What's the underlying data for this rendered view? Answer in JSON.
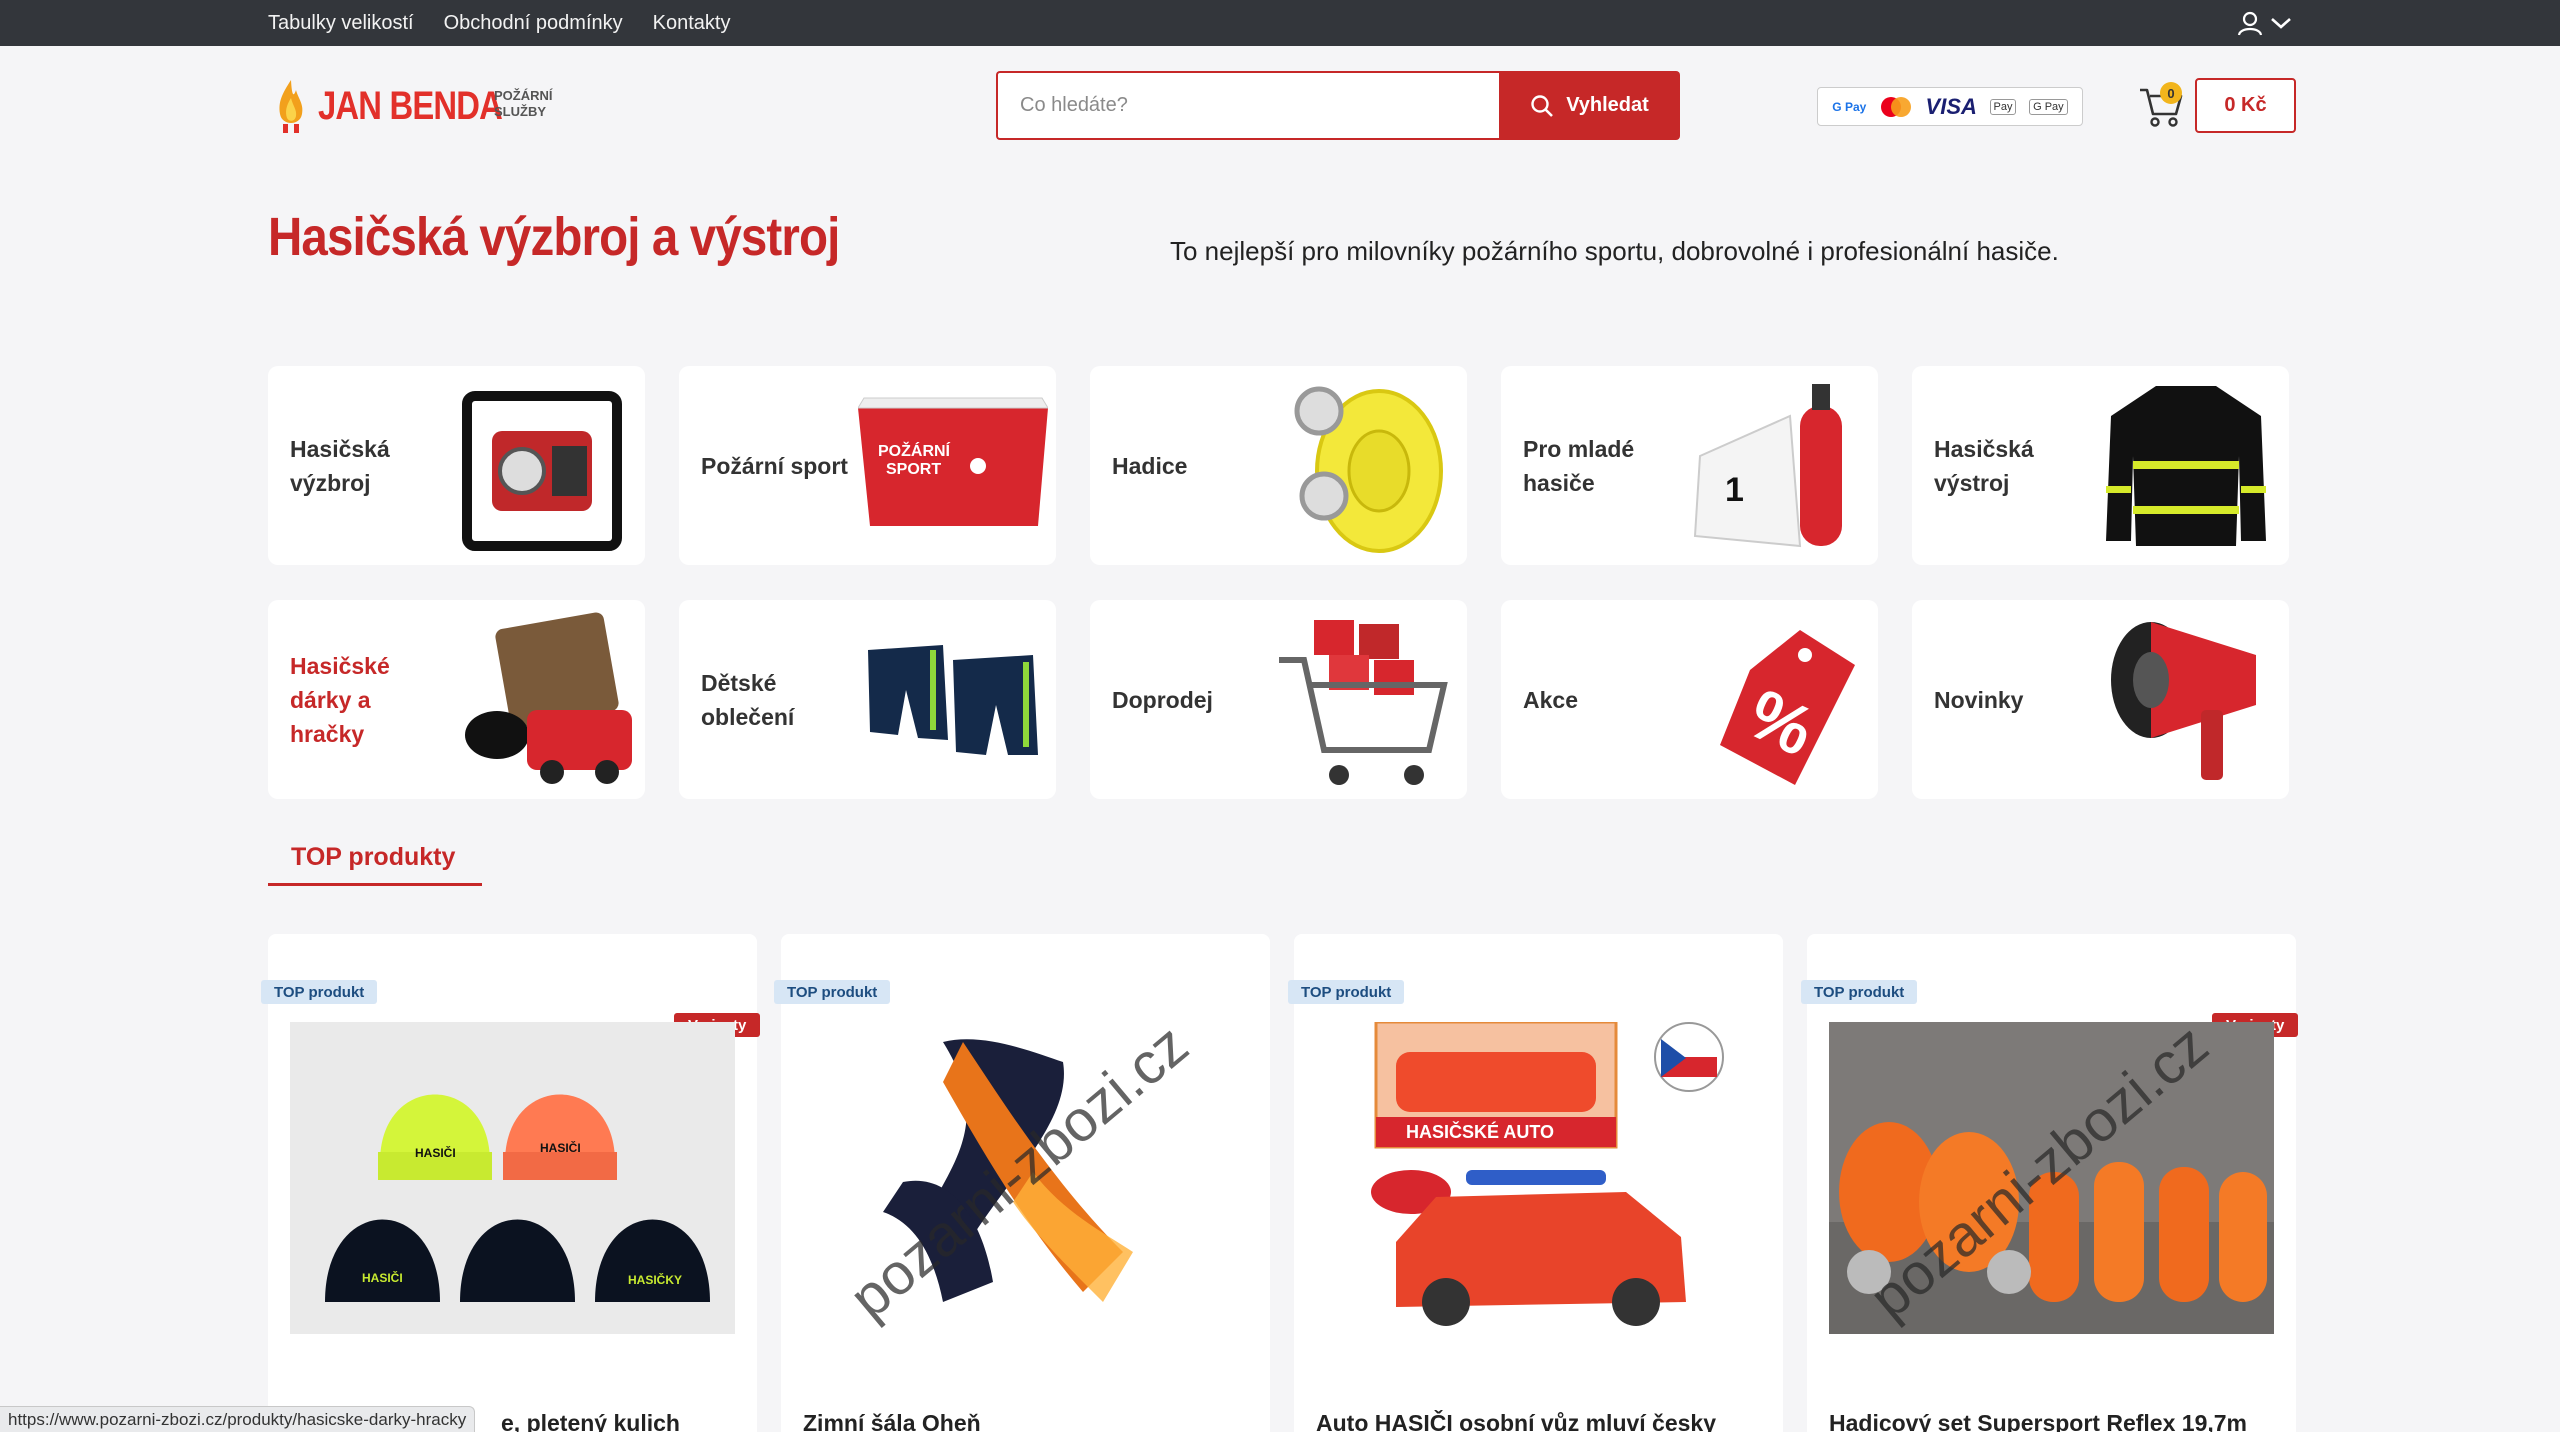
{
  "topbar": {
    "links": [
      "Tabulky velikostí",
      "Obchodní podmínky",
      "Kontakty"
    ]
  },
  "header": {
    "logo_name": "JAN BENDA",
    "logo_sub_1": "POŽÁRNÍ",
    "logo_sub_2": "SLUŽBY",
    "search_placeholder": "Co hledáte?",
    "search_button": "Vyhledat",
    "payments": [
      "G Pay",
      "VISA",
      "Pay",
      "G Pay"
    ],
    "cart_count": "0",
    "cart_total": "0 Kč"
  },
  "hero": {
    "title": "Hasičská výzbroj a výstroj",
    "subtitle": "To nejlepší pro milovníky požárního sportu, dobrovolné i profesionální hasiče."
  },
  "categories": [
    {
      "label": "Hasičská výzbroj",
      "icon": "fire-pump-icon"
    },
    {
      "label": "Požární sport",
      "icon": "water-tank-icon"
    },
    {
      "label": "Hadice",
      "icon": "fire-hose-icon"
    },
    {
      "label": "Pro mladé hasiče",
      "icon": "extinguisher-icon"
    },
    {
      "label": "Hasičská výstroj",
      "icon": "firefighter-jacket-icon"
    },
    {
      "label": "Hasičské dárky a hračky",
      "icon": "toy-fire-truck-icon"
    },
    {
      "label": "Dětské oblečení",
      "icon": "kids-shorts-icon"
    },
    {
      "label": "Doprodej",
      "icon": "shopping-cart-icon"
    },
    {
      "label": "Akce",
      "icon": "percent-tag-icon"
    },
    {
      "label": "Novinky",
      "icon": "megaphone-icon"
    }
  ],
  "top_section": {
    "title": "TOP produkty"
  },
  "products": [
    {
      "badge": "TOP produkt",
      "variant": "Varianty",
      "name": "e, pletený kulich",
      "icon": "beanies-image"
    },
    {
      "badge": "TOP produkt",
      "variant": "",
      "name": "Zimní šála Oheň",
      "icon": "scarf-image"
    },
    {
      "badge": "TOP produkt",
      "variant": "",
      "name": "Auto HASIČI osobní vůz mluví česky",
      "icon": "toy-car-image"
    },
    {
      "badge": "TOP produkt",
      "variant": "Varianty",
      "name": "Hadicový set Supersport Reflex 19,7m",
      "icon": "hose-set-image"
    }
  ],
  "watermark": "pozarni-zbozi.cz",
  "status_url": "https://www.pozarni-zbozi.cz/produkty/hasicske-darky-hracky",
  "colors": {
    "accent": "#c62828",
    "topbar": "#33363b",
    "badge_top": "#d7e6f5"
  }
}
